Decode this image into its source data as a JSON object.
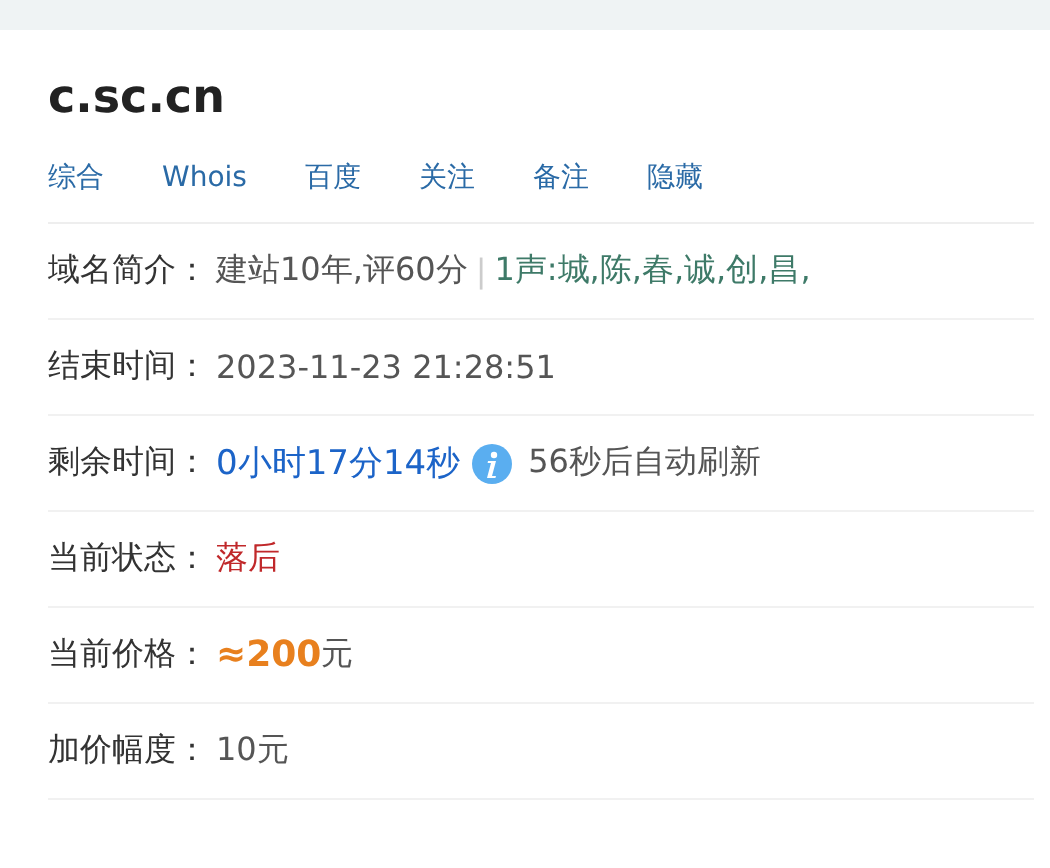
{
  "title": "c.sc.cn",
  "tabs": [
    {
      "label": "综合"
    },
    {
      "label": "Whois"
    },
    {
      "label": "百度"
    },
    {
      "label": "关注"
    },
    {
      "label": "备注"
    },
    {
      "label": "隐藏"
    }
  ],
  "rows": [
    {
      "kind": "intro",
      "label": "域名简介：",
      "value": "建站10年,评60分",
      "separator": "|",
      "extra": "1声:城,陈,春,诚,创,昌,"
    },
    {
      "kind": "plain",
      "label": "结束时间：",
      "value": "2023-11-23 21:28:51"
    },
    {
      "kind": "countdown",
      "label": "剩余时间：",
      "value": "0小时17分14秒",
      "extra": "56秒后自动刷新"
    },
    {
      "kind": "status",
      "label": "当前状态：",
      "value": "落后"
    },
    {
      "kind": "price",
      "label": "当前价格：",
      "value": "≈200",
      "unit": "元"
    },
    {
      "kind": "plain",
      "label": "加价幅度：",
      "value": "10元"
    }
  ]
}
